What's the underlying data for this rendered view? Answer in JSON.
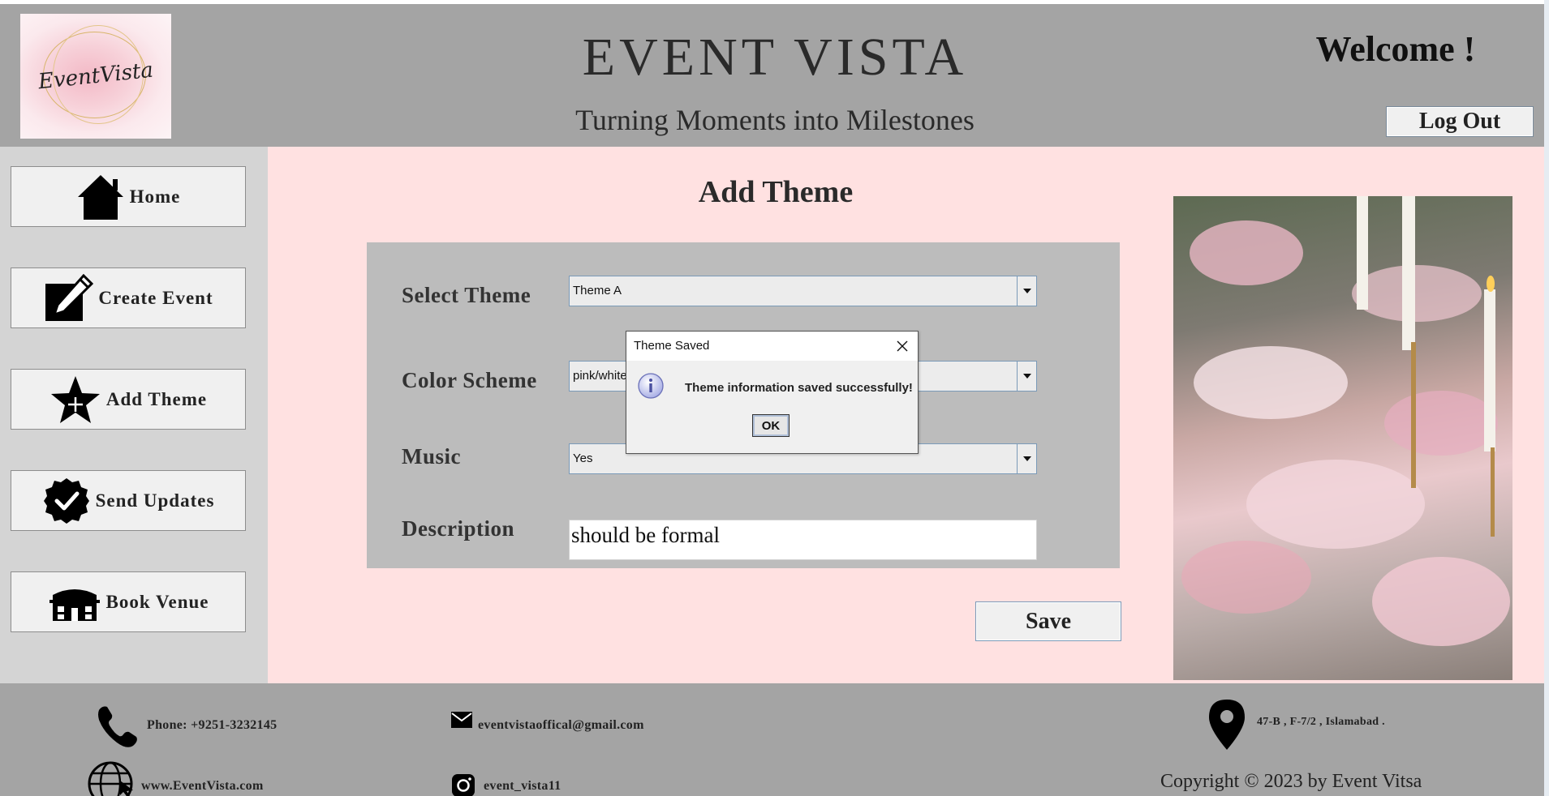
{
  "header": {
    "logo_text": "EventVista",
    "title": "EVENT VISTA",
    "tagline": "Turning Moments into Milestones",
    "welcome": "Welcome !",
    "logout_label": "Log Out"
  },
  "sidebar": {
    "items": [
      {
        "label": "Home",
        "icon": "home-icon"
      },
      {
        "label": "Create Event",
        "icon": "edit-icon"
      },
      {
        "label": "Add Theme",
        "icon": "star-plus-icon"
      },
      {
        "label": "Send Updates",
        "icon": "verified-badge-icon"
      },
      {
        "label": "Book Venue",
        "icon": "building-icon"
      }
    ]
  },
  "main": {
    "title": "Add Theme",
    "form": {
      "theme_label": "Select Theme",
      "theme_value": "Theme A",
      "color_label": "Color Scheme",
      "color_value": "pink/white",
      "music_label": "Music",
      "music_value": "Yes",
      "description_label": "Description",
      "description_value": "should be formal"
    },
    "save_label": "Save"
  },
  "dialog": {
    "title": "Theme Saved",
    "message": "Theme information saved successfully!",
    "ok_label": "OK",
    "icon": "info-icon"
  },
  "footer": {
    "phone": "Phone: +9251-3232145",
    "email": "eventvistaoffical@gmail.com",
    "address": "47-B , F-7/2  , Islamabad .",
    "website": "www.EventVista.com",
    "instagram": "event_vista11",
    "copyright": "Copyright © 2023 by Event Vitsa"
  },
  "colors": {
    "header_bg": "#a4a4a4",
    "sidebar_bg": "#d4d4d4",
    "main_bg": "#ffe1e1",
    "form_panel_bg": "#bcbcbc",
    "button_bg": "#f0f0f0"
  }
}
